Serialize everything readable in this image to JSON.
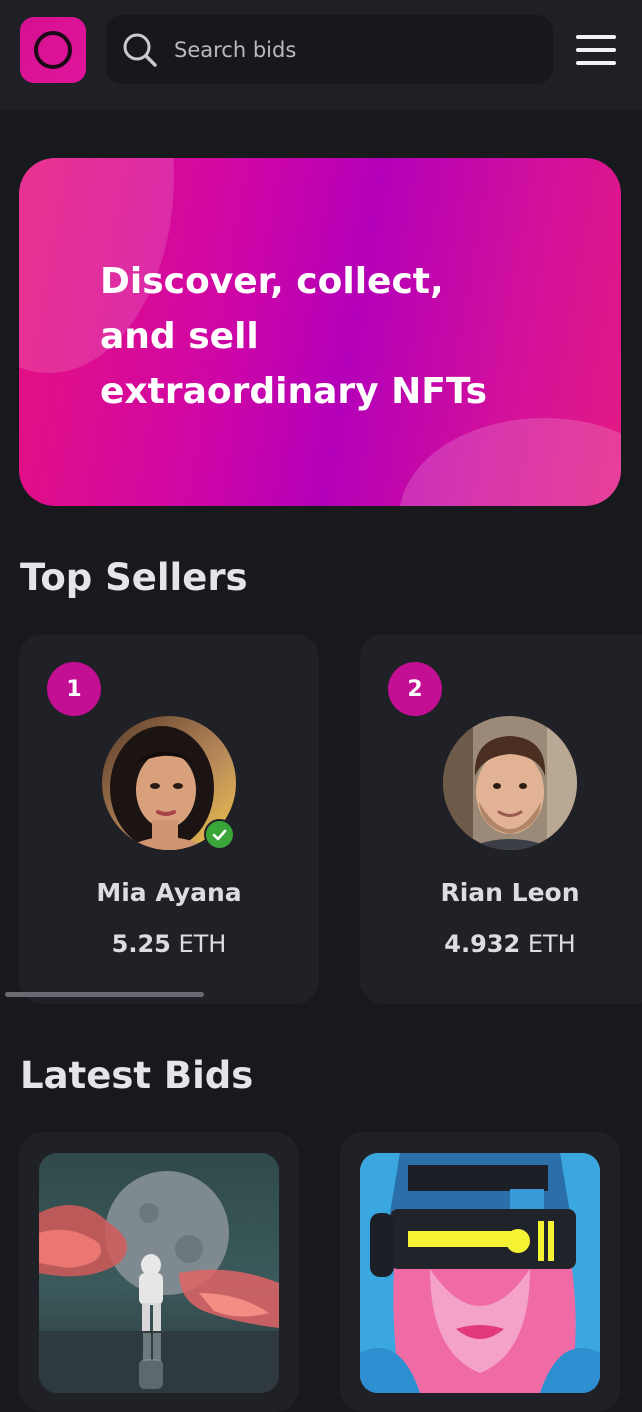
{
  "header": {
    "search_placeholder": "Search bids"
  },
  "hero": {
    "title_line1": "Discover, collect,",
    "title_line2": "and sell",
    "title_line3": "extraordinary NFTs"
  },
  "top_sellers": {
    "title": "Top Sellers",
    "sellers": [
      {
        "rank": "1",
        "name": "Mia Ayana",
        "amount": "5.25",
        "unit": "ETH",
        "verified": true
      },
      {
        "rank": "2",
        "name": "Rian Leon",
        "amount": "4.932",
        "unit": "ETH",
        "verified": false
      }
    ]
  },
  "latest_bids": {
    "title": "Latest Bids"
  },
  "colors": {
    "accent": "#c20f93",
    "background": "#18191d",
    "card": "#202127",
    "verified": "#3aa63a"
  }
}
